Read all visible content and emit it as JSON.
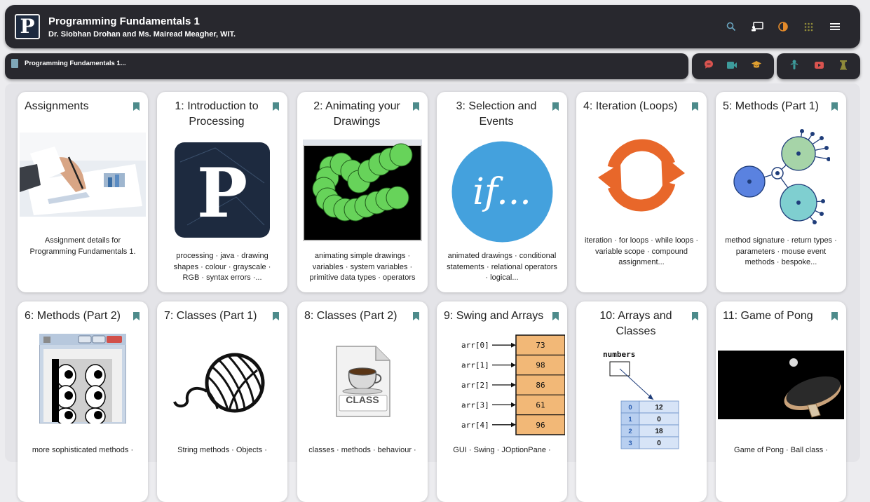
{
  "header": {
    "logo_letter": "P",
    "title": "Programming Fundamentals 1",
    "subtitle": "Dr. Siobhan Drohan and Ms. Mairead Meagher, WIT.",
    "icons": [
      "search-icon",
      "presentation-icon",
      "theme-toggle-icon",
      "apps-grid-icon",
      "menu-icon"
    ]
  },
  "breadcrumb": {
    "label": "Programming Fundamentals 1..."
  },
  "nav_icons": [
    "chat-icon",
    "video-icon",
    "graduation-cap-icon",
    "podcast-icon",
    "youtube-icon",
    "lab-icon"
  ],
  "colors": {
    "bar": "#28282e",
    "bookmark": "#4d8b8b",
    "search": "#6aa5bf",
    "theme": "#e38a2a",
    "grid": "#8f8a3a",
    "chat": "#d9534f",
    "video": "#3d9b9b",
    "cap": "#e0a030",
    "podcast": "#3d9b9b",
    "youtube": "#d9534f",
    "lab": "#8f8a3a"
  },
  "cards": [
    {
      "title": "Assignments",
      "desc": "Assignment details for Programming Fundamentals 1.",
      "image": "assignment-photo"
    },
    {
      "title": "1: Introduction to Processing",
      "desc": "processing · java · drawing shapes · colour · grayscale · RGB · syntax errors ·...",
      "image": "processing-logo"
    },
    {
      "title": "2: Animating your Drawings",
      "desc": "animating simple drawings · variables · system variables · primitive data types · operators",
      "image": "green-circles-sketch"
    },
    {
      "title": "3: Selection and Events",
      "desc": "animated drawings · conditional statements · relational operators · logical...",
      "image": "if-logo",
      "image_text": "if..."
    },
    {
      "title": "4: Iteration (Loops)",
      "desc": "iteration · for loops · while loops · variable scope · compound assignment...",
      "image": "loop-arrows"
    },
    {
      "title": "5: Methods (Part 1)",
      "desc": "method signature · return types · parameters · mouse event methods · bespoke...",
      "image": "network-circles"
    },
    {
      "title": "6: Methods (Part 2)",
      "desc": "more sophisticated methods ·",
      "image": "window-eyes-sketch"
    },
    {
      "title": "7: Classes (Part 1)",
      "desc": "String methods · Objects ·",
      "image": "yarn-ball"
    },
    {
      "title": "8: Classes (Part 2)",
      "desc": "classes · methods · behaviour ·",
      "image": "class-file-icon",
      "image_text": "CLASS"
    },
    {
      "title": "9: Swing and Arrays",
      "desc": "GUI · Swing · JOptionPane ·",
      "image": "array-diagram"
    },
    {
      "title": "10: Arrays and Classes",
      "desc": "",
      "image": "numbers-array-table"
    },
    {
      "title": "11: Game of Pong",
      "desc": "Game of Pong · Ball class ·",
      "image": "pong-paddle"
    }
  ],
  "array_diagram": {
    "labels": [
      "arr[0]",
      "arr[1]",
      "arr[2]",
      "arr[3]",
      "arr[4]"
    ],
    "values": [
      "73",
      "98",
      "86",
      "61",
      "96"
    ]
  },
  "numbers_table": {
    "name": "numbers",
    "rows": [
      [
        "0",
        "12"
      ],
      [
        "1",
        "0"
      ],
      [
        "2",
        "18"
      ],
      [
        "3",
        "0"
      ]
    ]
  }
}
